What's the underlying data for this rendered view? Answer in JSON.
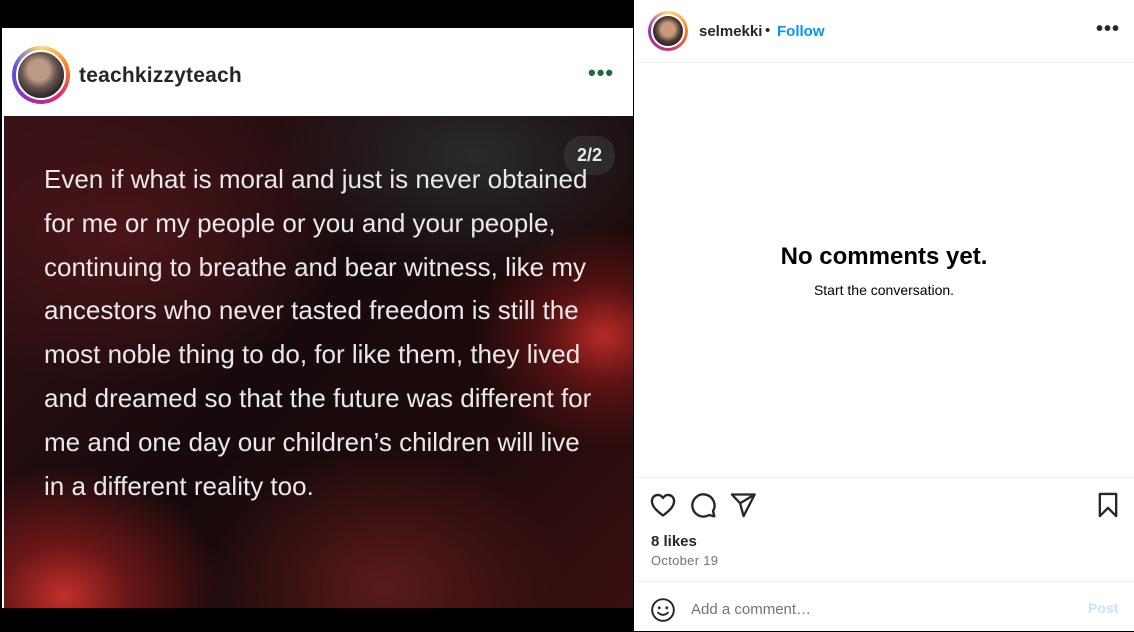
{
  "post": {
    "inner_username": "teachkizzyteach",
    "inner_more_label": "•••",
    "slide_counter": "2/2",
    "quote_text": "Even if what is moral and just is never obtained for me or my people or you and your people, continuing to breathe and bear witness, like my ancestors who never tasted freedom is still the most noble thing to do, for like them, they lived and dreamed so that the future was different for me and one day our children’s children will live in a different reality too."
  },
  "sidebar": {
    "username": "selmekki",
    "separator": "•",
    "follow_label": "Follow",
    "more_label": "•••",
    "empty_title": "No comments yet.",
    "empty_subtitle": "Start the conversation.",
    "likes": "8 likes",
    "date": "October 19",
    "comment_placeholder": "Add a comment…",
    "post_label": "Post"
  },
  "icons": {
    "like": "heart-icon",
    "comment": "comment-icon",
    "share": "share-icon",
    "save": "bookmark-icon",
    "emoji": "emoji-icon"
  },
  "colors": {
    "follow": "#0095f6",
    "post_disabled": "#c7e3fb",
    "inner_more": "#1e6b3a"
  }
}
